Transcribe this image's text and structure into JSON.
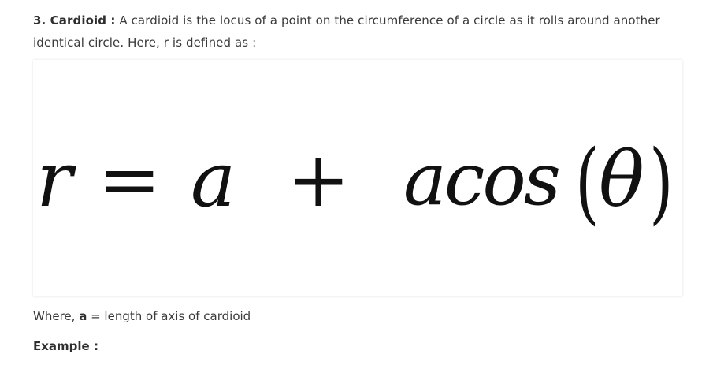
{
  "section": {
    "heading": "3. Cardioid :",
    "description": "A cardioid is the locus of a point on the circumference of a circle as it rolls around another identical circle. Here, r is defined as :"
  },
  "formula": {
    "r": "r",
    "equals": "=",
    "a": "a",
    "plus": "+",
    "acos": "acos",
    "open_paren": "(",
    "theta": "θ",
    "close_paren": ")"
  },
  "where": {
    "prefix": "Where,",
    "variable": "a",
    "definition": "= length of axis of cardioid"
  },
  "example": {
    "label": "Example :"
  }
}
